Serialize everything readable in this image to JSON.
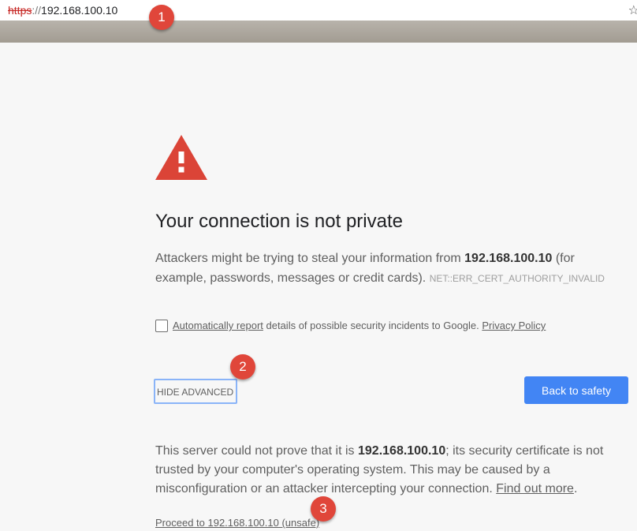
{
  "address_bar": {
    "scheme": "https",
    "separator": "://",
    "host": "192.168.100.10",
    "star_icon": "star-icon"
  },
  "interstitial": {
    "warning_icon": "warning-triangle-icon",
    "title": "Your connection is not private",
    "description_before": "Attackers might be trying to steal your information from ",
    "description_host": "192.168.100.10",
    "description_after": " (for example, passwords, messages or credit cards). ",
    "error_code": "NET::ERR_CERT_AUTHORITY_INVALID",
    "report_checkbox_checked": false,
    "report_link": "Automatically report",
    "report_text": " details of possible security incidents to Google. ",
    "privacy_link": "Privacy Policy",
    "hide_advanced": "HIDE ADVANCED",
    "back_to_safety": "Back to safety",
    "advanced_before": "This server could not prove that it is ",
    "advanced_host": "192.168.100.10",
    "advanced_after": "; its security certificate is not trusted by your computer's operating system. This may be caused by a misconfiguration or an attacker intercepting your connection. ",
    "find_out_more": "Find out more",
    "advanced_end": ".",
    "proceed_link": "Proceed to 192.168.100.10 (unsafe)"
  },
  "annotations": [
    "1",
    "2",
    "3"
  ],
  "colors": {
    "accent": "#4285f4",
    "warning": "#db4437",
    "badge": "#e0463a",
    "focus_ring": "#8ab4f8"
  }
}
